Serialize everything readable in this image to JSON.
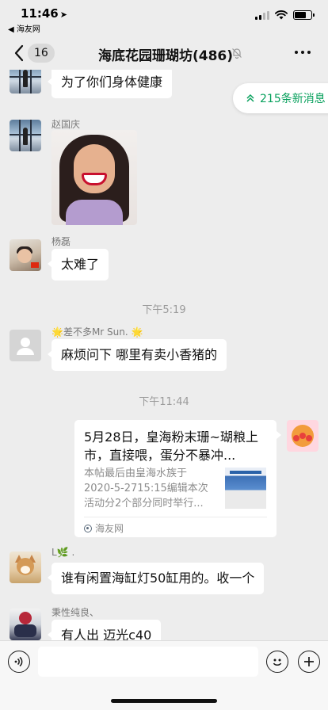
{
  "status_bar": {
    "time": "11:46",
    "back_app": "◀ 海友网"
  },
  "nav": {
    "back_count": "16",
    "title": "海底花园珊瑚坊(486)",
    "muted": true
  },
  "new_messages": {
    "label": "215条新消息"
  },
  "messages": [
    {
      "type": "text",
      "sender": "",
      "text": "为了你们身体健康",
      "avatar": "window-silhouette"
    },
    {
      "type": "image",
      "sender": "赵国庆",
      "avatar": "window-silhouette"
    },
    {
      "type": "text",
      "sender": "杨磊",
      "text": "太难了",
      "avatar": "child-photo"
    },
    {
      "type": "time",
      "text": "下午5:19"
    },
    {
      "type": "text",
      "sender": "🌟差不多Mr Sun. 🌟",
      "text": "麻烦问下 哪里有卖小香猪的",
      "avatar": "default-gray"
    },
    {
      "type": "time",
      "text": "下午11:44"
    },
    {
      "type": "link-card",
      "self": true,
      "title": "5月28日，皇海粉末珊~瑚粮上市，直接喂，蛋分不暴冲...",
      "description": "本帖最后由皇海水族于 2020-5-2715:15编辑本次活动分2个部分同时举行...",
      "source": "海友网",
      "avatar": "anpanman"
    },
    {
      "type": "text",
      "sender": "L🌿 .",
      "text": "谁有闲置海缸灯50缸用的。收一个",
      "avatar": "dog"
    },
    {
      "type": "text",
      "sender": "秉性纯良、",
      "text": "有人出 迈光c40",
      "avatar": "motorcycle"
    }
  ],
  "input_bar": {
    "value": "",
    "voice_icon": "voice-icon",
    "emoji_icon": "emoji-icon",
    "plus_icon": "plus-icon"
  },
  "colors": {
    "background": "#ededed",
    "bubble": "#ffffff",
    "accent_green": "#07a05c",
    "timestamp": "#9b9b9b"
  }
}
